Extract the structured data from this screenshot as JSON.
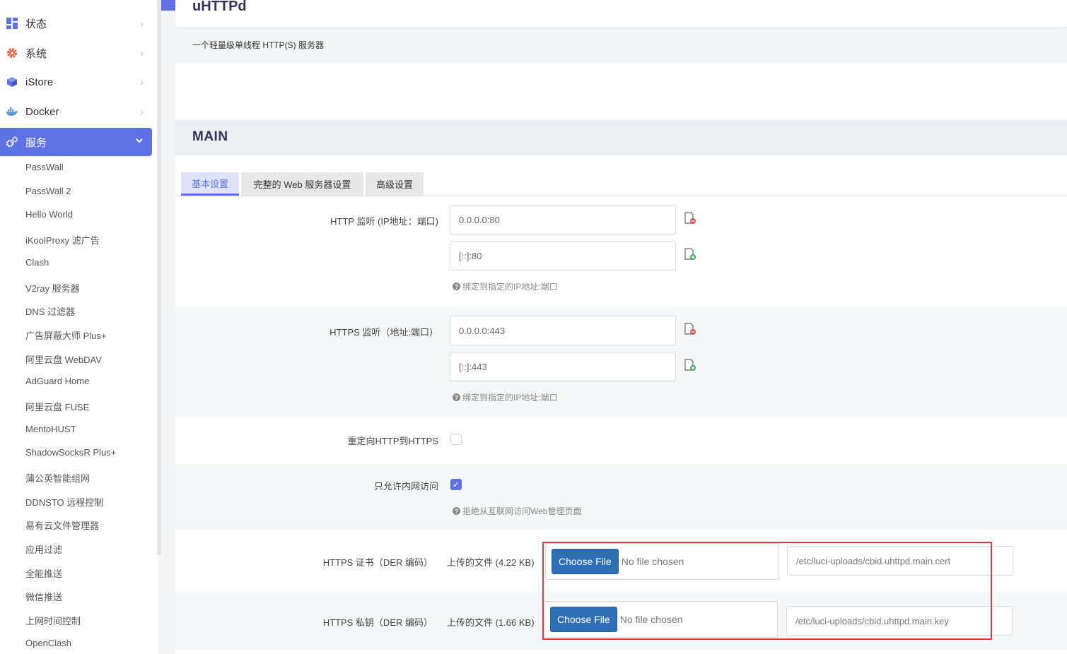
{
  "sidebar": {
    "top_items": [
      {
        "label": "状态",
        "icon": "dashboard-icon"
      },
      {
        "label": "系统",
        "icon": "gear-icon"
      },
      {
        "label": "iStore",
        "icon": "cube-icon"
      },
      {
        "label": "Docker",
        "icon": "docker-icon"
      },
      {
        "label": "服务",
        "icon": "cogs-icon",
        "active": true
      }
    ],
    "services": [
      "PassWall",
      "PassWall 2",
      "Hello World",
      "iKoolProxy 滤广告",
      "Clash",
      "V2ray 服务器",
      "DNS 过滤器",
      "广告屏蔽大师 Plus+",
      "阿里云盘 WebDAV",
      "AdGuard Home",
      "阿里云盘 FUSE",
      "MentoHUST",
      "ShadowSocksR Plus+",
      "蒲公英智能组网",
      "DDNSTO 远程控制",
      "易有云文件管理器",
      "应用过滤",
      "全能推送",
      "微信推送",
      "上网时间控制",
      "OpenClash"
    ]
  },
  "page": {
    "title": "uHTTPd",
    "description": "一个轻量级单线程 HTTP(S) 服务器",
    "section": "MAIN"
  },
  "tabs": [
    "基本设置",
    "完整的 Web 服务器设置",
    "高级设置"
  ],
  "form": {
    "http_listen": {
      "label": "HTTP 监听 (IP地址：端口)",
      "values": [
        "0.0.0.0:80",
        "[::]:80"
      ],
      "hint": "绑定到指定的IP地址:端口"
    },
    "https_listen": {
      "label": "HTTPS 监听（地址:端口）",
      "values": [
        "0.0.0.0:443",
        "[::]:443"
      ],
      "hint": "绑定到指定的IP地址:端口"
    },
    "redirect": {
      "label": "重定向HTTP到HTTPS",
      "checked": false
    },
    "lan_only": {
      "label": "只允许内网访问",
      "checked": true,
      "hint": "拒绝从互联网访问Web管理页面"
    },
    "cert": {
      "label": "HTTPS 证书（DER 编码）",
      "uploaded": "上传的文件 (4.22 KB)",
      "button": "Choose File",
      "nofile": "No file chosen",
      "path": "/etc/luci-uploads/cbid.uhttpd.main.cert"
    },
    "key": {
      "label": "HTTPS 私钥（DER 编码）",
      "uploaded": "上传的文件 (1.66 KB)",
      "button": "Choose File",
      "nofile": "No file chosen",
      "path": "/etc/luci-uploads/cbid.uhttpd.main.key"
    }
  },
  "colors": {
    "accent": "#5e72e4",
    "button": "#2f6fb5",
    "highlight": "#e0393e"
  }
}
